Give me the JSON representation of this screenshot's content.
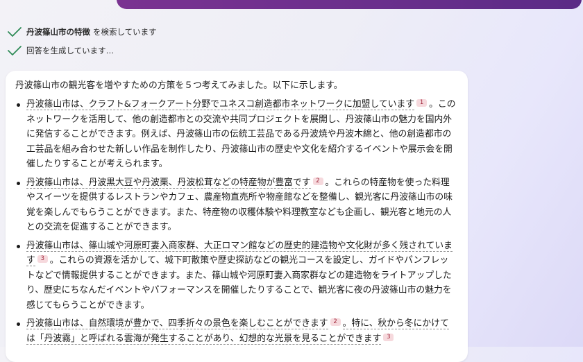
{
  "status": [
    {
      "bold": "丹波篠山市の特徴",
      "text": "を検索しています"
    },
    {
      "bold": "",
      "text": "回答を生成しています…"
    }
  ],
  "answer": {
    "intro": "丹波篠山市の観光客を増やすための方策を５つ考えてみました。以下に示します。",
    "points": [
      {
        "claim": "丹波篠山市は、クラフト&フォークアート分野でユネスコ創造都市ネットワークに加盟しています",
        "cite": "1",
        "rest": "。このネットワークを活用して、他の創造都市との交流や共同プロジェクトを展開し、丹波篠山市の魅力を国内外に発信することができます。例えば、丹波篠山市の伝統工芸品である丹波焼や丹波木綿と、他の創造都市の工芸品を組み合わせた新しい作品を制作したり、丹波篠山市の歴史や文化を紹介するイベントや展示会を開催したりすることが考えられます。"
      },
      {
        "claim": "丹波篠山市は、丹波黒大豆や丹波栗、丹波松茸などの特産物が豊富です",
        "cite": "2",
        "rest": "。これらの特産物を使った料理やスイーツを提供するレストランやカフェ、農産物直売所や物産館などを整備し、観光客に丹波篠山市の味覚を楽しんでもらうことができます。また、特産物の収穫体験や料理教室なども企画し、観光客と地元の人との交流を促進することができます。"
      },
      {
        "claim": "丹波篠山市は、篠山城や河原町妻入商家群、大正ロマン館などの歴史的建造物や文化財が多く残されています",
        "cite": "3",
        "rest": "。これらの資源を活かして、城下町散策や歴史探訪などの観光コースを設定し、ガイドやパンフレットなどで情報提供することができます。また、篠山城や河原町妻入商家群などの建造物をライトアップしたり、歴史にちなんだイベントやパフォーマンスを開催したりすることで、観光客に夜の丹波篠山市の魅力を感じてもらうことができます。"
      },
      {
        "claim": "丹波篠山市は、自然環境が豊かで、四季折々の景色を楽しむことができます",
        "cite": "2",
        "rest": "。特に、秋から冬にかけては「丹波霧」と呼ばれる雲海が発生することがあり、幻想的な光景を見ることができます",
        "cite2": "3"
      }
    ]
  }
}
